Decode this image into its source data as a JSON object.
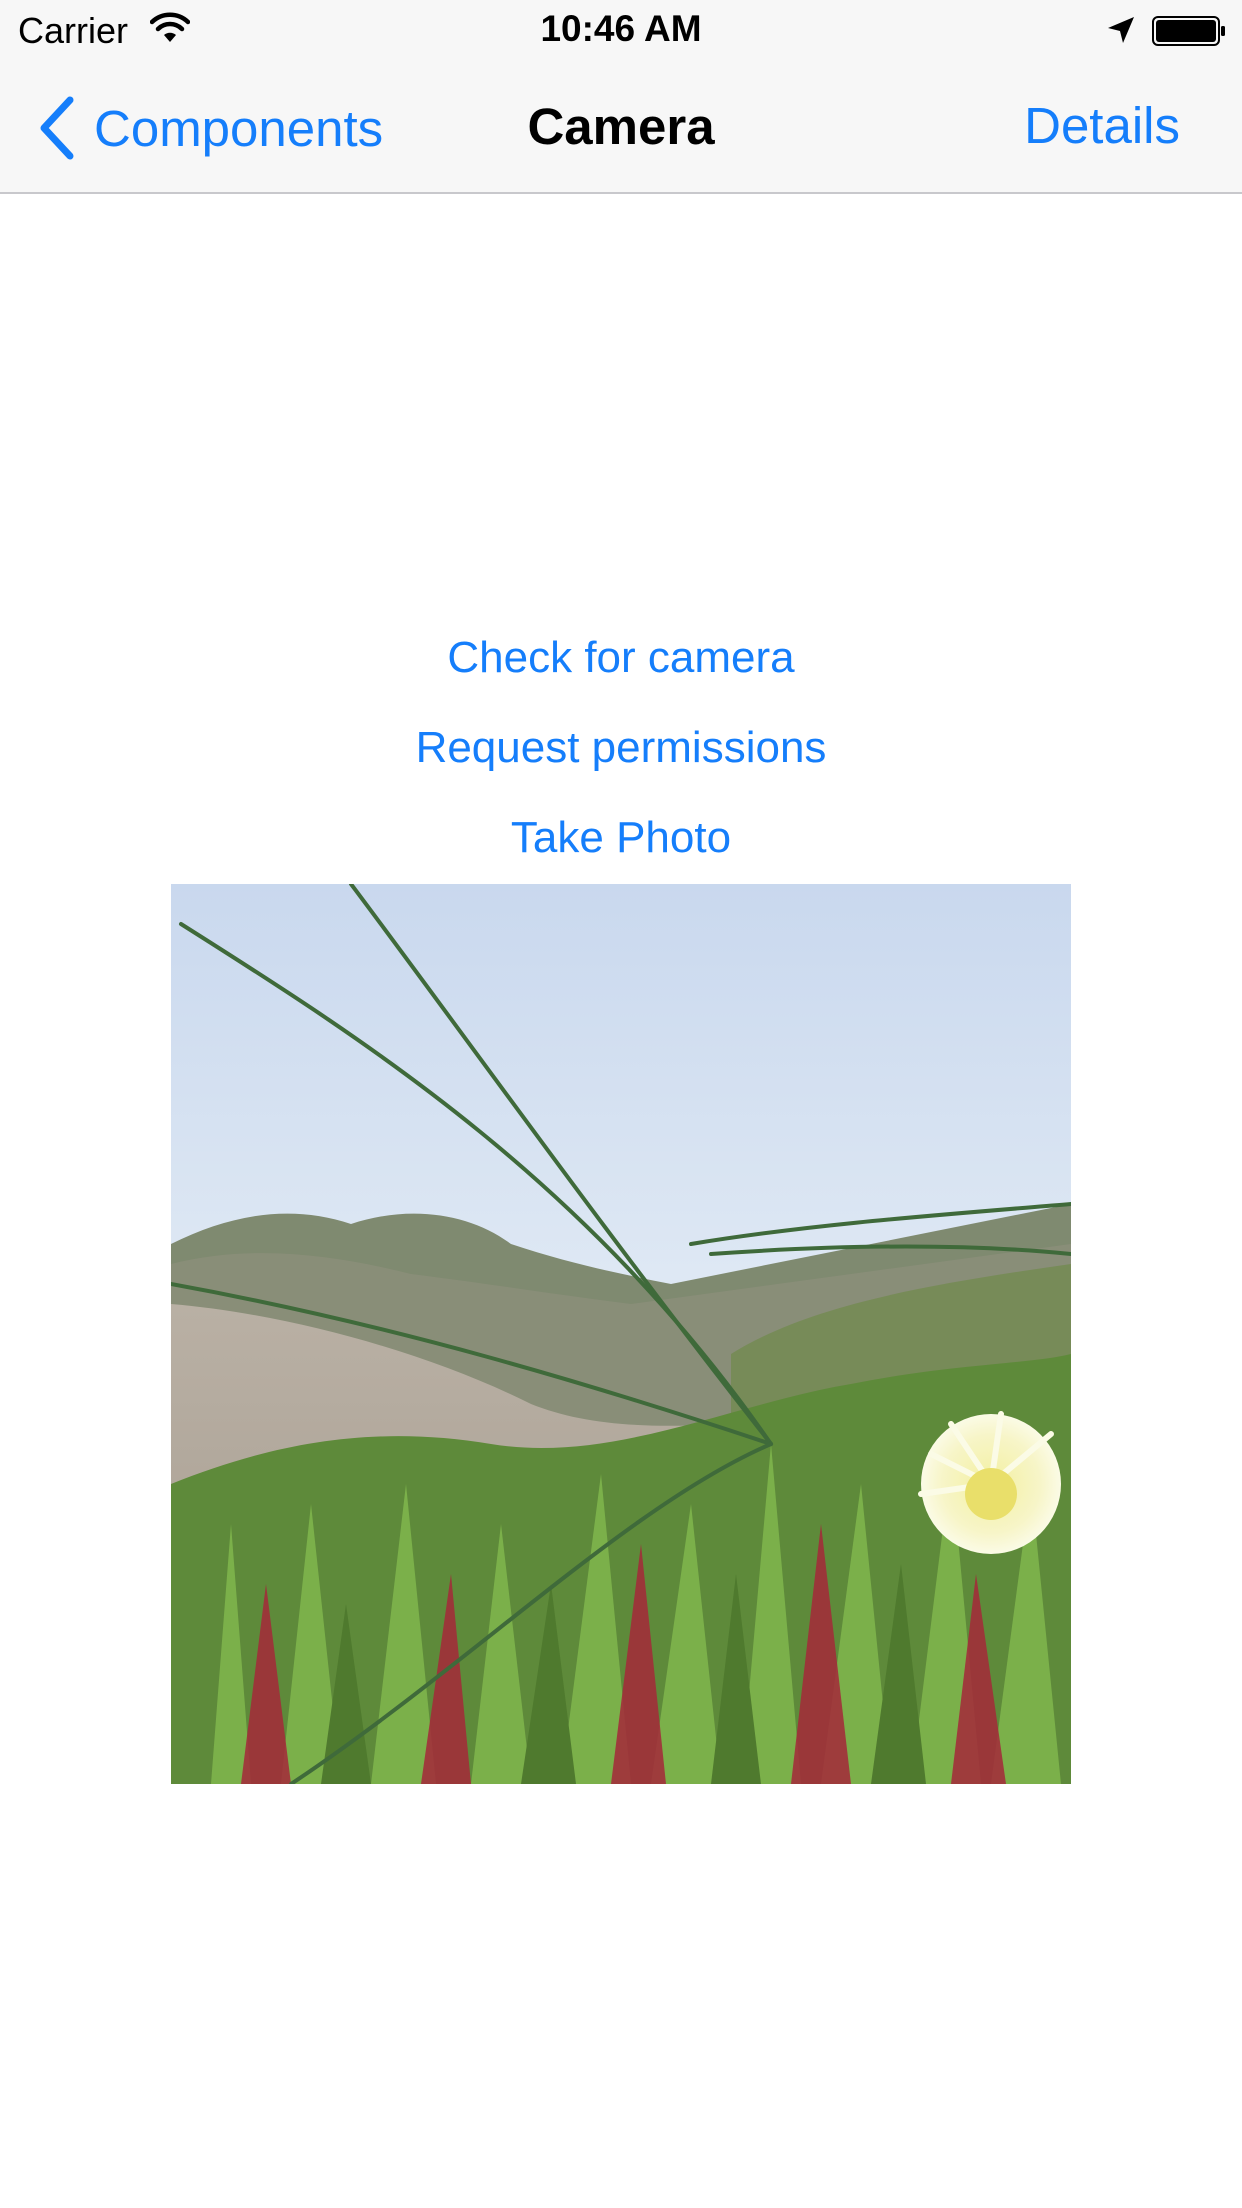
{
  "status_bar": {
    "carrier": "Carrier",
    "time": "10:46 AM",
    "icons": [
      "wifi-icon",
      "location-arrow-icon",
      "battery-icon"
    ]
  },
  "nav": {
    "back_label": "Components",
    "title": "Camera",
    "right_label": "Details"
  },
  "actions": {
    "check_camera": "Check for camera",
    "request_permissions": "Request permissions",
    "take_photo": "Take Photo"
  },
  "colors": {
    "accent": "#157efb",
    "bar_background": "#f7f7f7"
  }
}
